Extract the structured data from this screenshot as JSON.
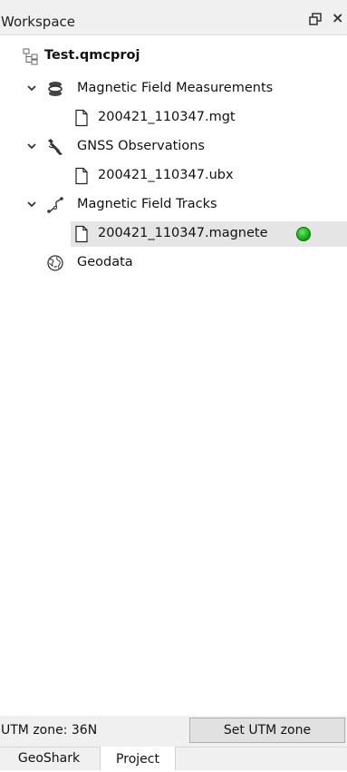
{
  "panel": {
    "title": "Workspace",
    "float_icon": "float-window-icon",
    "close_icon": "close-icon",
    "close_glyph": "×"
  },
  "tree": {
    "project": {
      "label": "Test.qmcproj",
      "icon": "project-tree-icon"
    },
    "groups": [
      {
        "label": "Magnetic Field Measurements",
        "icon": "magnetometer-icon",
        "expanded": true,
        "children": [
          {
            "label": "200421_110347.mgt",
            "icon": "file-icon"
          }
        ]
      },
      {
        "label": "GNSS Observations",
        "icon": "satellite-icon",
        "expanded": true,
        "children": [
          {
            "label": "200421_110347.ubx",
            "icon": "file-icon"
          }
        ]
      },
      {
        "label": "Magnetic Field Tracks",
        "icon": "track-icon",
        "expanded": true,
        "children": [
          {
            "label": "200421_110347.magnete",
            "icon": "file-icon",
            "selected": true,
            "status_color": "#18b418"
          }
        ]
      }
    ],
    "geodata": {
      "label": "Geodata",
      "icon": "globe-icon"
    }
  },
  "bottom": {
    "utm_label": "UTM zone: 36N",
    "set_button": "Set UTM zone"
  },
  "tabs": [
    {
      "label": "GeoShark",
      "active": false
    },
    {
      "label": "Project",
      "active": true
    }
  ]
}
